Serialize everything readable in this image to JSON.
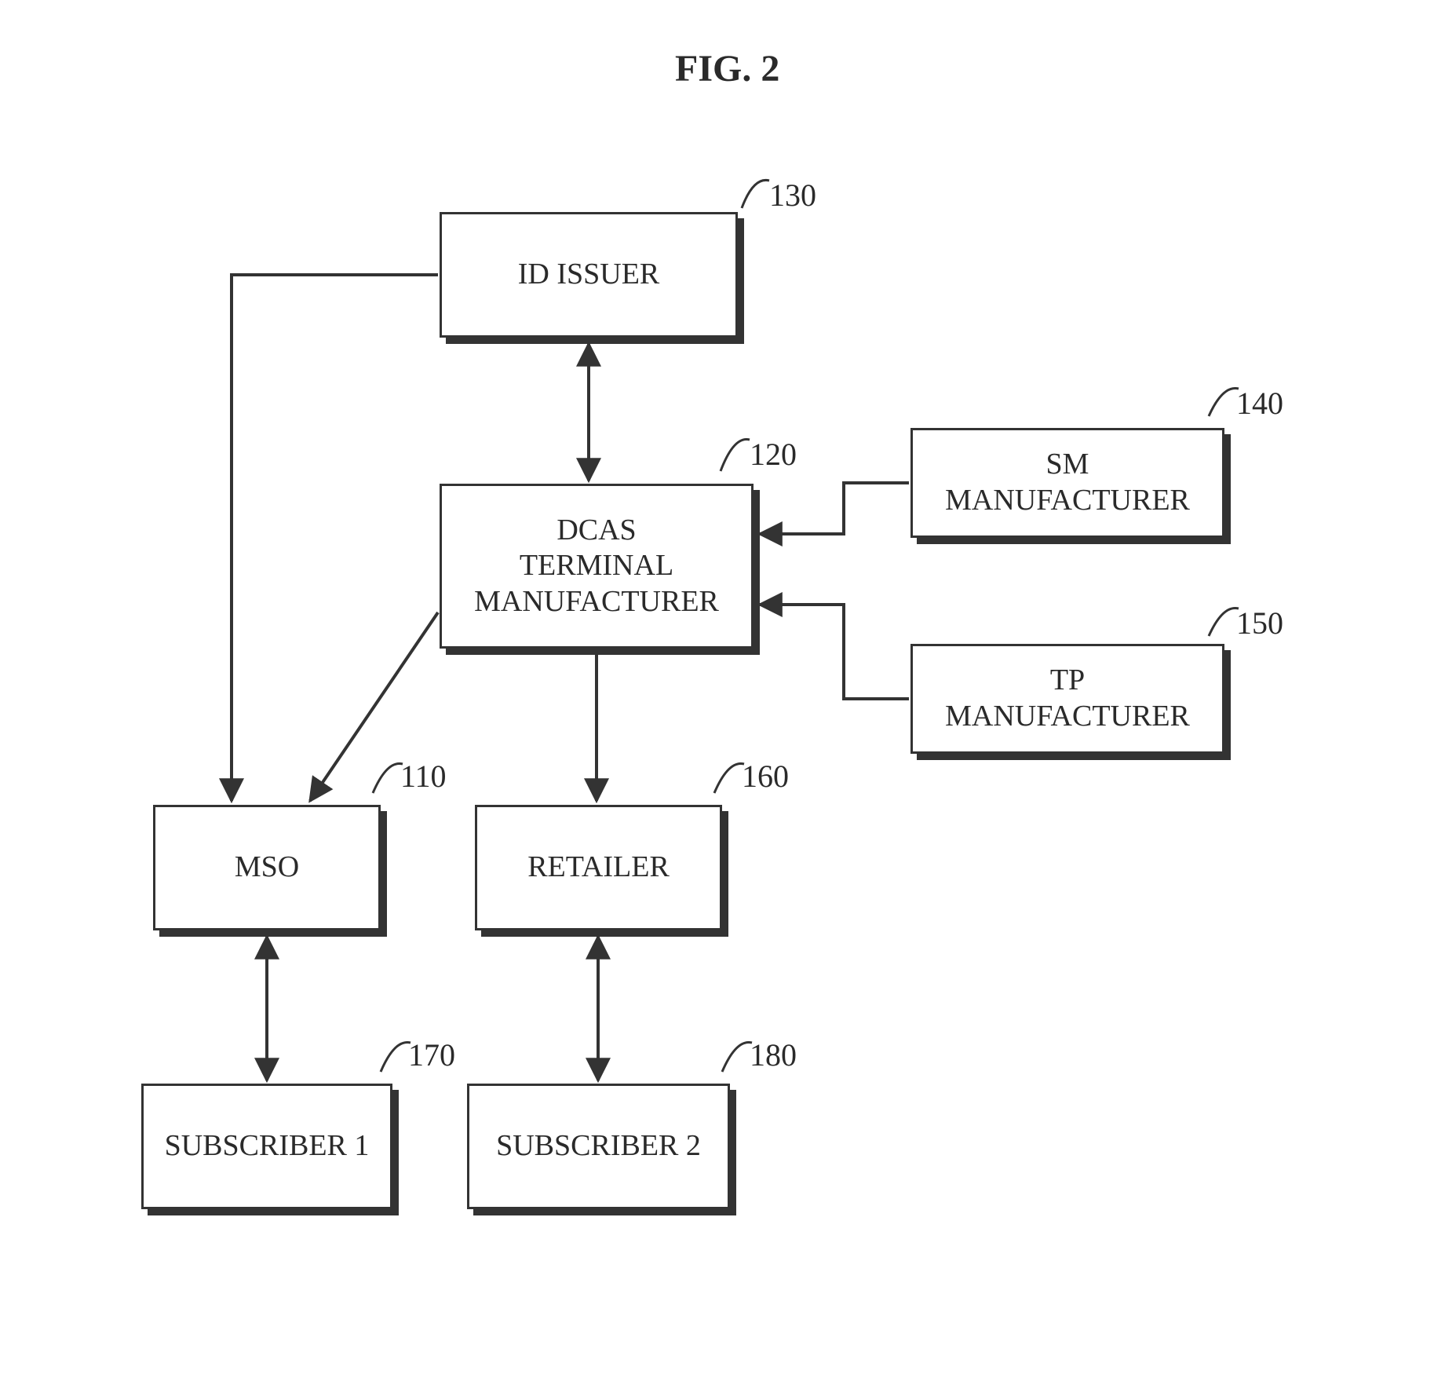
{
  "figure_title": "FIG. 2",
  "boxes": {
    "id_issuer": {
      "label": "ID ISSUER",
      "ref": "130"
    },
    "dcas": {
      "label": "DCAS\nTERMINAL\nMANUFACTURER",
      "ref": "120"
    },
    "sm_mfr": {
      "label": "SM\nMANUFACTURER",
      "ref": "140"
    },
    "tp_mfr": {
      "label": "TP\nMANUFACTURER",
      "ref": "150"
    },
    "mso": {
      "label": "MSO",
      "ref": "110"
    },
    "retailer": {
      "label": "RETAILER",
      "ref": "160"
    },
    "sub1": {
      "label": "SUBSCRIBER 1",
      "ref": "170"
    },
    "sub2": {
      "label": "SUBSCRIBER 2",
      "ref": "180"
    }
  },
  "chart_data": {
    "type": "diagram",
    "title": "FIG. 2",
    "nodes": [
      {
        "id": "110",
        "label": "MSO"
      },
      {
        "id": "120",
        "label": "DCAS TERMINAL MANUFACTURER"
      },
      {
        "id": "130",
        "label": "ID ISSUER"
      },
      {
        "id": "140",
        "label": "SM MANUFACTURER"
      },
      {
        "id": "150",
        "label": "TP MANUFACTURER"
      },
      {
        "id": "160",
        "label": "RETAILER"
      },
      {
        "id": "170",
        "label": "SUBSCRIBER 1"
      },
      {
        "id": "180",
        "label": "SUBSCRIBER 2"
      }
    ],
    "edges": [
      {
        "from": "130",
        "to": "120",
        "bidirectional": true
      },
      {
        "from": "130",
        "to": "110",
        "bidirectional": false
      },
      {
        "from": "140",
        "to": "120",
        "bidirectional": false
      },
      {
        "from": "150",
        "to": "120",
        "bidirectional": false
      },
      {
        "from": "120",
        "to": "110",
        "bidirectional": false
      },
      {
        "from": "120",
        "to": "160",
        "bidirectional": false
      },
      {
        "from": "110",
        "to": "170",
        "bidirectional": true
      },
      {
        "from": "160",
        "to": "180",
        "bidirectional": true
      }
    ]
  }
}
